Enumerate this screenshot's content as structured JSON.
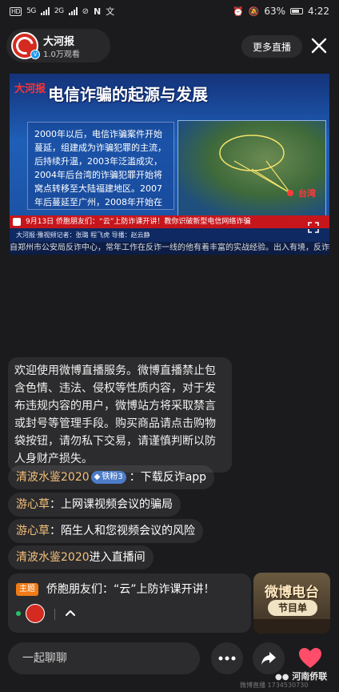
{
  "status_bar": {
    "left_icons": [
      "hd-icon",
      "5g-signal-icon",
      "4g-signal-icon",
      "wifi-off-icon",
      "n-icon",
      "text-icon"
    ],
    "signal_1": "5G",
    "signal_2": "2G",
    "battery": "63%",
    "time": "4:22"
  },
  "header": {
    "host_name": "大河报",
    "views": "1.0万观看",
    "more_live_label": "更多直播"
  },
  "video": {
    "logo_text": "大河报",
    "title": "电信诈骗的起源与发展",
    "body": "2000年以后，电信诈骗案件开始蔓延，组建成为诈骗犯罪的主流，后持续升温，2003年泛滥成灾，2004年后台湾的诈骗犯罪开始将窝点转移至大陆福建地区。2007年后蔓延至广州，2008年开始在",
    "map_label": "台湾",
    "ticker": "9月13日   侨胞朋友们：“云”上防诈课开讲！教你识破新型电信网络诈骗",
    "credit": "大河报·豫视频记者：张璐 程飞虎   导播：赵云静",
    "subtitle": "自郑州市公安局反诈中心，常年工作在反诈一线的他有着丰富的实战经验。出入有境，反诈"
  },
  "notice": "欢迎使用微博直播服务。微博直播禁止包含色情、违法、侵权等性质内容，对于发布违规内容的用户，微博站方将采取禁言或封号等管理手段。购买商品请点击购物袋按钮，请勿私下交易，请谨慎判断以防人身财产损失。",
  "chat": [
    {
      "user": "清波水鉴2020",
      "badge": "铁粉3",
      "text": "：下载反诈app"
    },
    {
      "user": "游心草",
      "badge": "",
      "text": "：上网课视频会议的骗局"
    },
    {
      "user": "游心草",
      "badge": "",
      "text": "：陌生人和您视频会议的风险"
    },
    {
      "user": "清波水鉴2020",
      "badge": "",
      "text": "进入直播间"
    }
  ],
  "pinned": {
    "tag": "主题",
    "text": "侨胞朋友们：“云”上防诈课开讲！"
  },
  "schedule": {
    "title": "微博电台",
    "subtitle": "节目单"
  },
  "bottom": {
    "input_placeholder": "一起聊聊",
    "watermark": "河南侨联",
    "watermark_sub": "微博直播 1734530730"
  },
  "colors": {
    "background": "#1b1b1d",
    "username": "#f4c07a",
    "badge": "#4d7cc9",
    "topic_tag": "#f07b16",
    "heart": "#ff4d6a",
    "ticker": "#c6161c"
  }
}
